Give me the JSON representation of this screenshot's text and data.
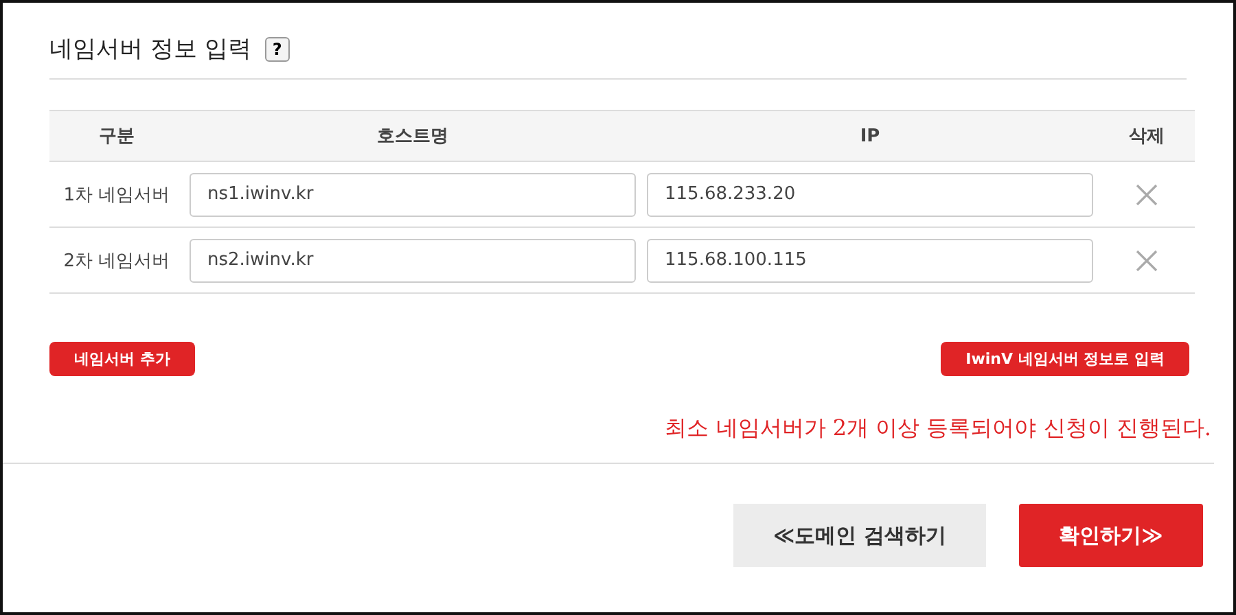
{
  "title": "네임서버 정보 입력",
  "help": "?",
  "table": {
    "columns": [
      "구분",
      "호스트명",
      "IP",
      "삭제"
    ],
    "rows": [
      {
        "label": "1차 네임서버",
        "host": "ns1.iwinv.kr",
        "ip": "115.68.233.20"
      },
      {
        "label": "2차 네임서버",
        "host": "ns2.iwinv.kr",
        "ip": "115.68.100.115"
      }
    ]
  },
  "add_button": "네임서버 추가",
  "iwinv_button": "IwinV 네임서버 정보로 입력",
  "notice": "최소 네임서버가 2개 이상 등록되어야 신청이 진행된다.",
  "back_button": "≪도메인 검색하기",
  "confirm_button": "확인하기≫"
}
